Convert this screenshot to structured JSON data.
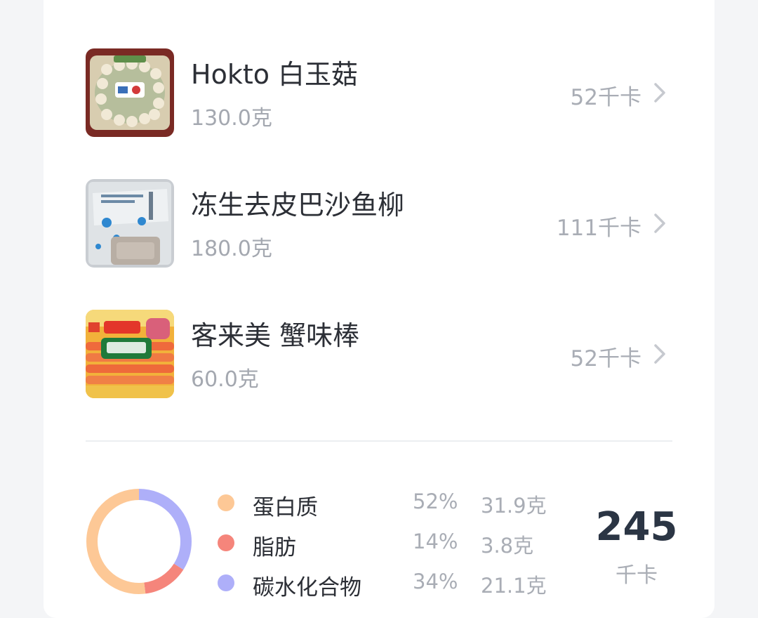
{
  "foods": [
    {
      "name": "Hokto 白玉菇",
      "weight": "130.0克",
      "calories": "52千卡",
      "image_icon": "mushroom-package-photo"
    },
    {
      "name": "冻生去皮巴沙鱼柳",
      "weight": "180.0克",
      "calories": "111千卡",
      "image_icon": "frozen-fish-package-photo"
    },
    {
      "name": "客来美 蟹味棒",
      "weight": "60.0克",
      "calories": "52千卡",
      "image_icon": "crab-stick-package-photo"
    }
  ],
  "nutrition": {
    "chart_data": {
      "type": "pie",
      "categories": [
        "蛋白质",
        "脂肪",
        "碳水化合物"
      ],
      "values": [
        52,
        14,
        34
      ],
      "colors": [
        "#fdc896",
        "#f5857b",
        "#aeaff9"
      ]
    },
    "items": [
      {
        "name": "蛋白质",
        "percent": "52%",
        "grams": "31.9克",
        "color": "#fdc896"
      },
      {
        "name": "脂肪",
        "percent": "14%",
        "grams": "3.8克",
        "color": "#f5857b"
      },
      {
        "name": "碳水化合物",
        "percent": "34%",
        "grams": "21.1克",
        "color": "#aeaff9"
      }
    ],
    "total": "245",
    "total_unit": "千卡"
  }
}
